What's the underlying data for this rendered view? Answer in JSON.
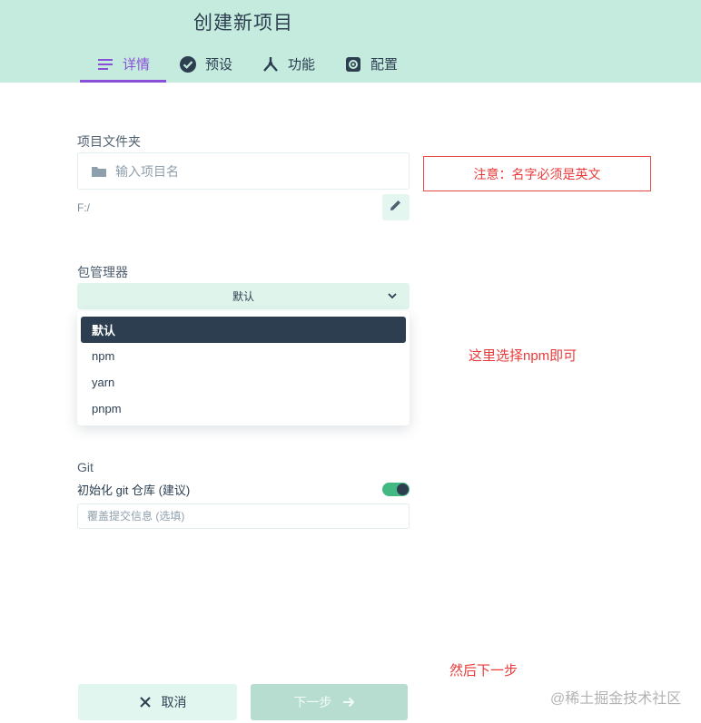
{
  "header": {
    "title": "创建新项目",
    "tabs": [
      {
        "label": "详情",
        "icon": "list-icon",
        "active": true
      },
      {
        "label": "预设",
        "icon": "check-circle-icon",
        "active": false
      },
      {
        "label": "功能",
        "icon": "merge-icon",
        "active": false
      },
      {
        "label": "配置",
        "icon": "settings-icon",
        "active": false
      }
    ]
  },
  "details": {
    "folder_label": "项目文件夹",
    "name_placeholder": "输入项目名",
    "name_value": "",
    "path": "F:/",
    "package_manager_label": "包管理器",
    "package_manager_selected": "默认",
    "package_manager_options": [
      "默认",
      "npm",
      "yarn",
      "pnpm"
    ],
    "git_label": "Git",
    "git_init_label": "初始化 git 仓库 (建议)",
    "git_init_enabled": true,
    "commit_placeholder": "覆盖提交信息 (选填)"
  },
  "annotations": {
    "name_note": "注意：名字必须是英文",
    "npm_note": "这里选择npm即可",
    "next_note": "然后下一步"
  },
  "footer": {
    "cancel_label": "取消",
    "next_label": "下一步"
  },
  "watermark": "@稀土掘金技术社区",
  "colors": {
    "header_bg": "#c4ebde",
    "accent": "#8a4fd8",
    "primary_dark": "#2c3e50",
    "toggle_green": "#42b983",
    "annotation_red": "#e83a3a"
  }
}
